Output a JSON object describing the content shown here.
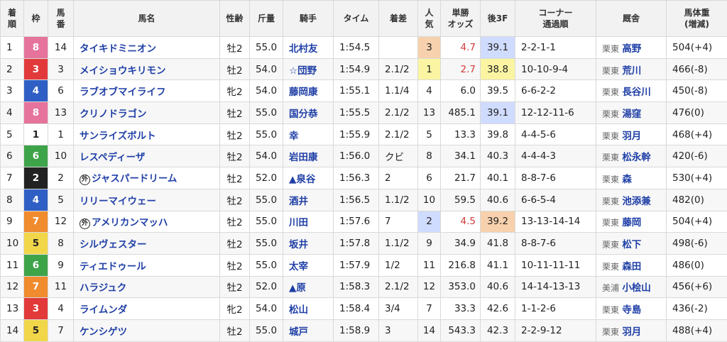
{
  "columns": [
    "着順",
    "枠",
    "馬番",
    "馬名",
    "性齢",
    "斤量",
    "騎手",
    "タイム",
    "着差",
    "人気",
    "単勝オッズ",
    "後3F",
    "コーナー通過順",
    "厩舎",
    "馬体重(増減)"
  ],
  "header_lines": {
    "rank": [
      "着",
      "順"
    ],
    "waku": [
      "枠"
    ],
    "umaban": [
      "馬",
      "番"
    ],
    "horse": [
      "馬名"
    ],
    "sexage": [
      "性齢"
    ],
    "weight": [
      "斤量"
    ],
    "jockey": [
      "騎手"
    ],
    "time": [
      "タイム"
    ],
    "margin": [
      "着差"
    ],
    "pop": [
      "人",
      "気"
    ],
    "odds": [
      "単勝",
      "オッズ"
    ],
    "f3": [
      "後3F"
    ],
    "corner": [
      "コーナー",
      "通過順"
    ],
    "stable": [
      "厩舎"
    ],
    "bw": [
      "馬体重",
      "(増減)"
    ]
  },
  "waku_colors": {
    "1": {
      "bg": "#ffffff",
      "fg": "#222222"
    },
    "2": {
      "bg": "#222222",
      "fg": "#ffffff"
    },
    "3": {
      "bg": "#e23a3a",
      "fg": "#ffffff"
    },
    "4": {
      "bg": "#2f5fc4",
      "fg": "#ffffff"
    },
    "5": {
      "bg": "#f2d64a",
      "fg": "#222222"
    },
    "6": {
      "bg": "#3ea449",
      "fg": "#ffffff"
    },
    "7": {
      "bg": "#f08b2e",
      "fg": "#ffffff"
    },
    "8": {
      "bg": "#e6739b",
      "fg": "#ffffff"
    }
  },
  "highlight_colors": {
    "pop1": "#fbf5a3",
    "pop2": "#cfdcff",
    "pop3": "#f7d1ad",
    "f3_best": "#fbf5a3",
    "f3_second": "#cfdcff",
    "f3_third": "#f7d1ad",
    "odds_red": "#d23b3b"
  },
  "rows": [
    {
      "rank": "1",
      "waku": "8",
      "umaban": "14",
      "horse": "タイキドミニオン",
      "mark": "",
      "sexage": "牡2",
      "weight": "55.0",
      "jockey": "北村友",
      "time": "1:54.5",
      "margin": "",
      "pop": "3",
      "odds": "4.7",
      "f3": "39.1",
      "corner": "2-2-1-1",
      "region": "栗東",
      "trainer": "高野",
      "bw": "504(+4)"
    },
    {
      "rank": "2",
      "waku": "3",
      "umaban": "3",
      "horse": "メイショウキリモン",
      "mark": "",
      "sexage": "牡2",
      "weight": "54.0",
      "jockey": "☆団野",
      "time": "1:54.9",
      "margin": "2.1/2",
      "pop": "1",
      "odds": "2.7",
      "f3": "38.8",
      "corner": "10-10-9-4",
      "region": "栗東",
      "trainer": "荒川",
      "bw": "466(-8)"
    },
    {
      "rank": "3",
      "waku": "4",
      "umaban": "6",
      "horse": "ラブオブマイライフ",
      "mark": "",
      "sexage": "牝2",
      "weight": "54.0",
      "jockey": "藤岡康",
      "time": "1:55.1",
      "margin": "1.1/4",
      "pop": "4",
      "odds": "6.0",
      "f3": "39.5",
      "corner": "6-6-2-2",
      "region": "栗東",
      "trainer": "長谷川",
      "bw": "450(-8)"
    },
    {
      "rank": "4",
      "waku": "8",
      "umaban": "13",
      "horse": "クリノドラゴン",
      "mark": "",
      "sexage": "牡2",
      "weight": "55.0",
      "jockey": "国分恭",
      "time": "1:55.5",
      "margin": "2.1/2",
      "pop": "13",
      "odds": "485.1",
      "f3": "39.1",
      "corner": "12-12-11-6",
      "region": "栗東",
      "trainer": "湯窪",
      "bw": "476(0)"
    },
    {
      "rank": "5",
      "waku": "1",
      "umaban": "1",
      "horse": "サンライズボルト",
      "mark": "",
      "sexage": "牡2",
      "weight": "55.0",
      "jockey": "幸",
      "time": "1:55.9",
      "margin": "2.1/2",
      "pop": "5",
      "odds": "13.3",
      "f3": "39.8",
      "corner": "4-4-5-6",
      "region": "栗東",
      "trainer": "羽月",
      "bw": "468(+4)"
    },
    {
      "rank": "6",
      "waku": "6",
      "umaban": "10",
      "horse": "レスペディーザ",
      "mark": "",
      "sexage": "牡2",
      "weight": "54.0",
      "jockey": "岩田康",
      "time": "1:56.0",
      "margin": "クビ",
      "pop": "8",
      "odds": "34.1",
      "f3": "40.3",
      "corner": "4-4-4-3",
      "region": "栗東",
      "trainer": "松永幹",
      "bw": "420(-6)"
    },
    {
      "rank": "7",
      "waku": "2",
      "umaban": "2",
      "horse": "ジャスパードリーム",
      "mark": "外",
      "sexage": "牡2",
      "weight": "52.0",
      "jockey": "▲泉谷",
      "time": "1:56.3",
      "margin": "2",
      "pop": "6",
      "odds": "21.7",
      "f3": "40.1",
      "corner": "8-8-7-6",
      "region": "栗東",
      "trainer": "森",
      "bw": "530(+4)"
    },
    {
      "rank": "8",
      "waku": "4",
      "umaban": "5",
      "horse": "リリーマイウェー",
      "mark": "",
      "sexage": "牡2",
      "weight": "55.0",
      "jockey": "酒井",
      "time": "1:56.5",
      "margin": "1.1/2",
      "pop": "10",
      "odds": "59.5",
      "f3": "40.6",
      "corner": "6-6-5-4",
      "region": "栗東",
      "trainer": "池添兼",
      "bw": "482(0)"
    },
    {
      "rank": "9",
      "waku": "7",
      "umaban": "12",
      "horse": "アメリカンマッハ",
      "mark": "外",
      "sexage": "牡2",
      "weight": "55.0",
      "jockey": "川田",
      "time": "1:57.6",
      "margin": "7",
      "pop": "2",
      "odds": "4.5",
      "f3": "39.2",
      "corner": "13-13-14-14",
      "region": "栗東",
      "trainer": "藤岡",
      "bw": "504(+4)"
    },
    {
      "rank": "10",
      "waku": "5",
      "umaban": "8",
      "horse": "シルヴェスター",
      "mark": "",
      "sexage": "牡2",
      "weight": "55.0",
      "jockey": "坂井",
      "time": "1:57.8",
      "margin": "1.1/2",
      "pop": "9",
      "odds": "34.9",
      "f3": "41.8",
      "corner": "8-8-7-6",
      "region": "栗東",
      "trainer": "松下",
      "bw": "498(-6)"
    },
    {
      "rank": "11",
      "waku": "6",
      "umaban": "9",
      "horse": "ティエドゥール",
      "mark": "",
      "sexage": "牡2",
      "weight": "55.0",
      "jockey": "太宰",
      "time": "1:57.9",
      "margin": "1/2",
      "pop": "11",
      "odds": "216.8",
      "f3": "41.1",
      "corner": "10-11-11-11",
      "region": "栗東",
      "trainer": "森田",
      "bw": "486(0)"
    },
    {
      "rank": "12",
      "waku": "7",
      "umaban": "11",
      "horse": "ハラジュク",
      "mark": "",
      "sexage": "牡2",
      "weight": "52.0",
      "jockey": "▲原",
      "time": "1:58.3",
      "margin": "2.1/2",
      "pop": "12",
      "odds": "353.0",
      "f3": "40.6",
      "corner": "14-14-13-13",
      "region": "美浦",
      "trainer": "小桧山",
      "bw": "456(+6)"
    },
    {
      "rank": "13",
      "waku": "3",
      "umaban": "4",
      "horse": "ライムンダ",
      "mark": "",
      "sexage": "牝2",
      "weight": "54.0",
      "jockey": "松山",
      "time": "1:58.4",
      "margin": "3/4",
      "pop": "7",
      "odds": "33.3",
      "f3": "42.6",
      "corner": "1-1-2-6",
      "region": "栗東",
      "trainer": "寺島",
      "bw": "436(-2)"
    },
    {
      "rank": "14",
      "waku": "5",
      "umaban": "7",
      "horse": "ケンシゲツ",
      "mark": "",
      "sexage": "牡2",
      "weight": "55.0",
      "jockey": "城戸",
      "time": "1:58.9",
      "margin": "3",
      "pop": "14",
      "odds": "543.3",
      "f3": "42.3",
      "corner": "2-2-9-12",
      "region": "栗東",
      "trainer": "羽月",
      "bw": "488(+4)"
    }
  ]
}
